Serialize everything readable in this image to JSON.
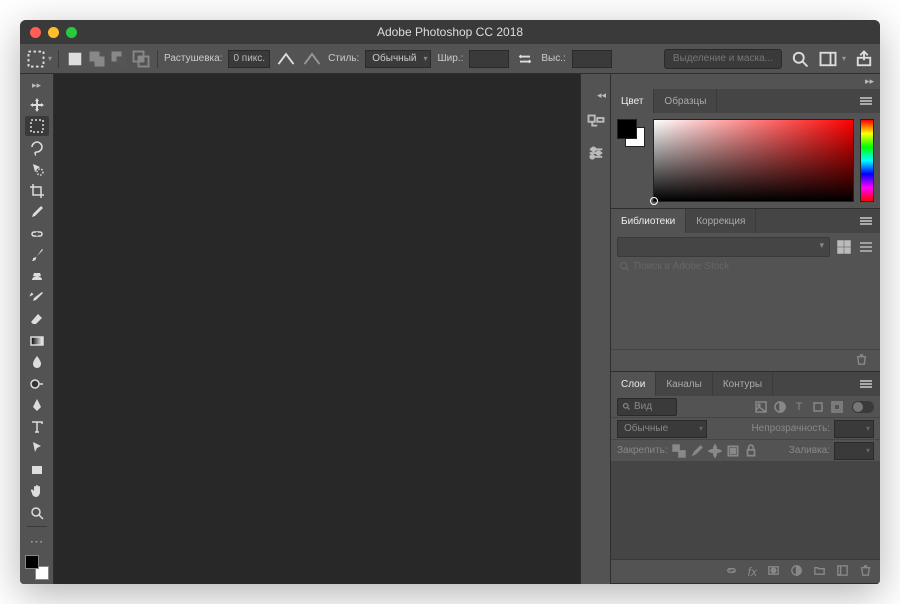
{
  "title": "Adobe Photoshop CC 2018",
  "optionsBar": {
    "featherLabel": "Растушевка:",
    "featherValue": "0 пикс.",
    "styleLabel": "Стиль:",
    "styleValue": "Обычный",
    "widthLabel": "Шир.:",
    "widthValue": "",
    "heightLabel": "Выс.:",
    "heightValue": "",
    "selectMaskBtn": "Выделение и маска..."
  },
  "toolbox": {
    "tools": [
      "move-tool",
      "marquee-tool",
      "lasso-tool",
      "quick-select-tool",
      "crop-tool",
      "eyedropper-tool",
      "healing-brush-tool",
      "brush-tool",
      "clone-stamp-tool",
      "history-brush-tool",
      "eraser-tool",
      "gradient-tool",
      "blur-tool",
      "dodge-tool",
      "pen-tool",
      "type-tool",
      "path-select-tool",
      "rectangle-tool",
      "hand-tool",
      "zoom-tool"
    ]
  },
  "colorPanel": {
    "tabs": [
      "Цвет",
      "Образцы"
    ],
    "activeTab": 0
  },
  "libPanel": {
    "tabs": [
      "Библиотеки",
      "Коррекция"
    ],
    "activeTab": 0,
    "searchPlaceholder": "Поиск в Adobe Stock"
  },
  "layersPanel": {
    "tabs": [
      "Слои",
      "Каналы",
      "Контуры"
    ],
    "activeTab": 0,
    "kindLabel": "Вид",
    "blendMode": "Обычные",
    "opacityLabel": "Непрозрачность:",
    "lockLabel": "Закрепить:",
    "fillLabel": "Заливка:"
  }
}
